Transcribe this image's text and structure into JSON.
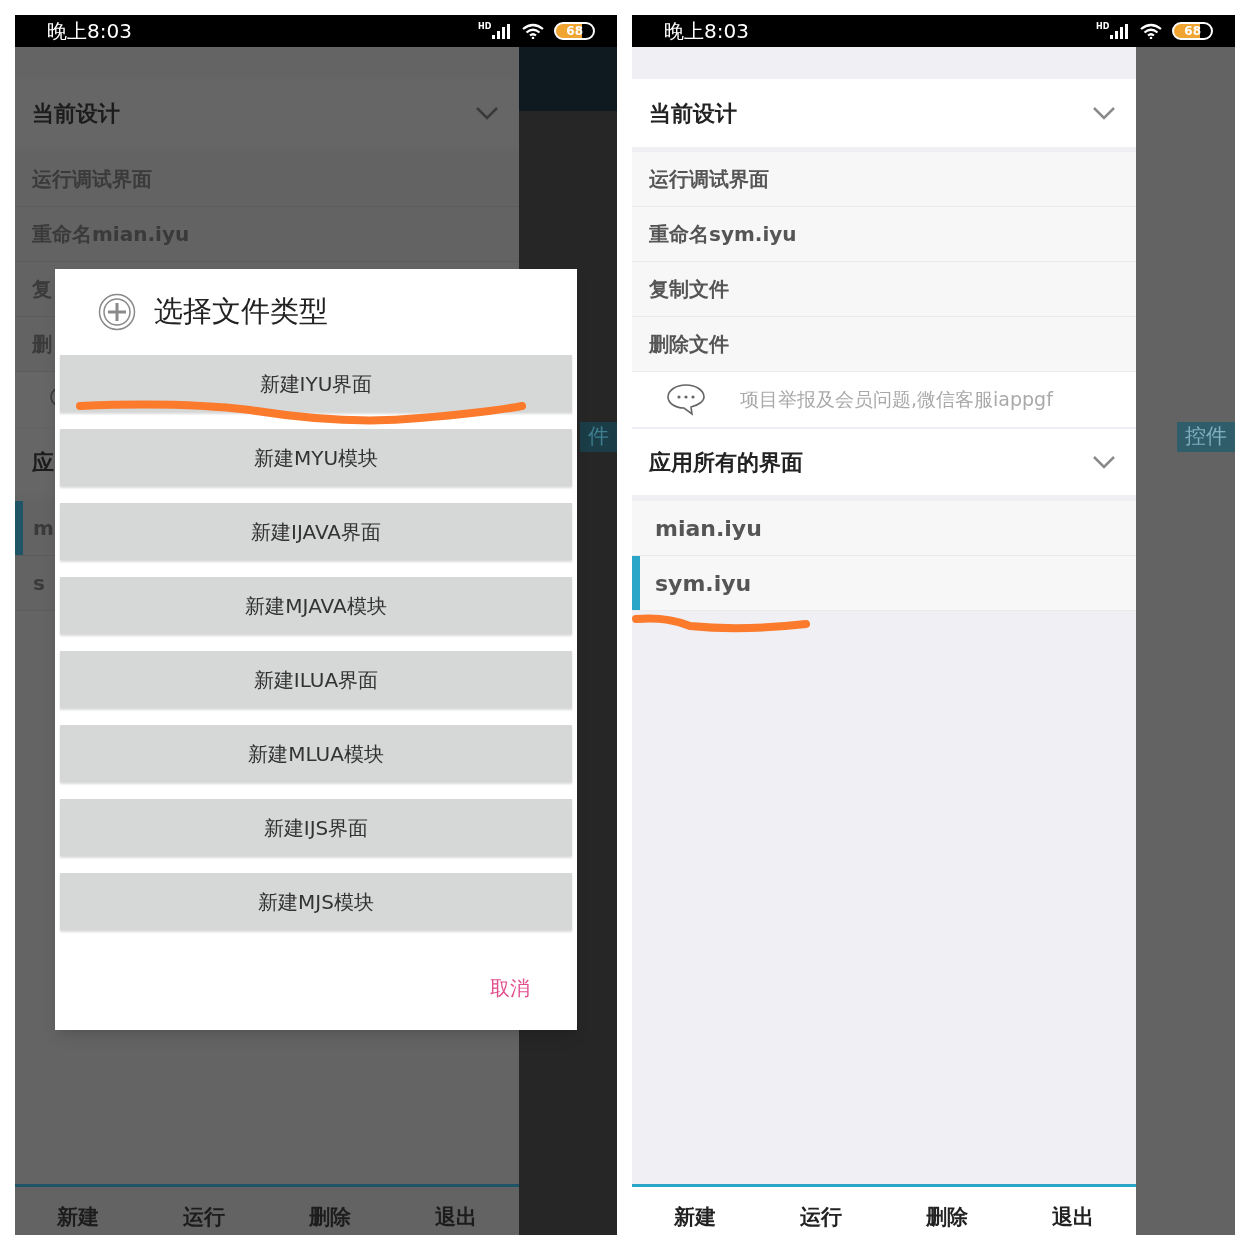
{
  "phones": [
    {
      "dimmed": true,
      "status_bar": {
        "time": "晚上8:03",
        "network": "HD",
        "battery": "68"
      },
      "drawer": {
        "current_header": "当前设计",
        "actions": [
          "运行调试界面",
          "重命名mian.iyu",
          "复",
          "删"
        ],
        "files_header": "应",
        "files": [
          {
            "name": "m",
            "selected": true
          },
          {
            "name": "s",
            "selected": false
          }
        ]
      },
      "side_tab": "件",
      "bottom_tabs": [
        "新建",
        "运行",
        "删除",
        "退出"
      ],
      "dialog": {
        "title": "选择文件类型",
        "options": [
          "新建IYU界面",
          "新建MYU模块",
          "新建IJAVA界面",
          "新建MJAVA模块",
          "新建ILUA界面",
          "新建MLUA模块",
          "新建IJS界面",
          "新建MJS模块"
        ],
        "cancel": "取消"
      }
    },
    {
      "dimmed": false,
      "status_bar": {
        "time": "晚上8:03",
        "network": "HD",
        "battery": "68"
      },
      "drawer": {
        "current_header": "当前设计",
        "actions": [
          "运行调试界面",
          "重命名sym.iyu",
          "复制文件",
          "删除文件"
        ],
        "notice": {
          "text": "项目举报及会员问题,微信客服iappgf"
        },
        "files_header": "应用所有的界面",
        "files": [
          {
            "name": "mian.iyu",
            "selected": false
          },
          {
            "name": "sym.iyu",
            "selected": true
          }
        ]
      },
      "side_tab": "控件",
      "bottom_tabs": [
        "新建",
        "运行",
        "删除",
        "退出"
      ]
    }
  ]
}
